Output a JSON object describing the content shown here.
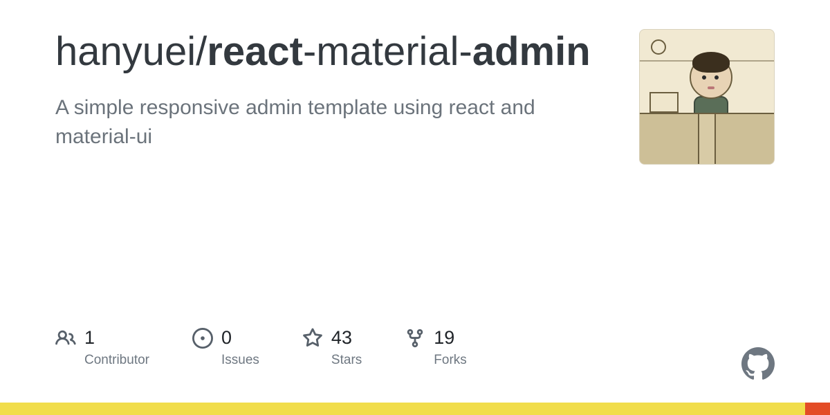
{
  "title": {
    "owner": "hanyuei",
    "slash": "/",
    "repo_parts": [
      "react",
      "-material-",
      "admin"
    ]
  },
  "description": "A simple responsive admin template using react and material-ui",
  "stats": [
    {
      "icon": "people-icon",
      "count": "1",
      "label": "Contributor"
    },
    {
      "icon": "issue-icon",
      "count": "0",
      "label": "Issues"
    },
    {
      "icon": "star-icon",
      "count": "43",
      "label": "Stars"
    },
    {
      "icon": "fork-icon",
      "count": "19",
      "label": "Forks"
    }
  ],
  "colors": {
    "bar_primary": "#f1dd4b",
    "bar_accent": "#e34c26"
  }
}
